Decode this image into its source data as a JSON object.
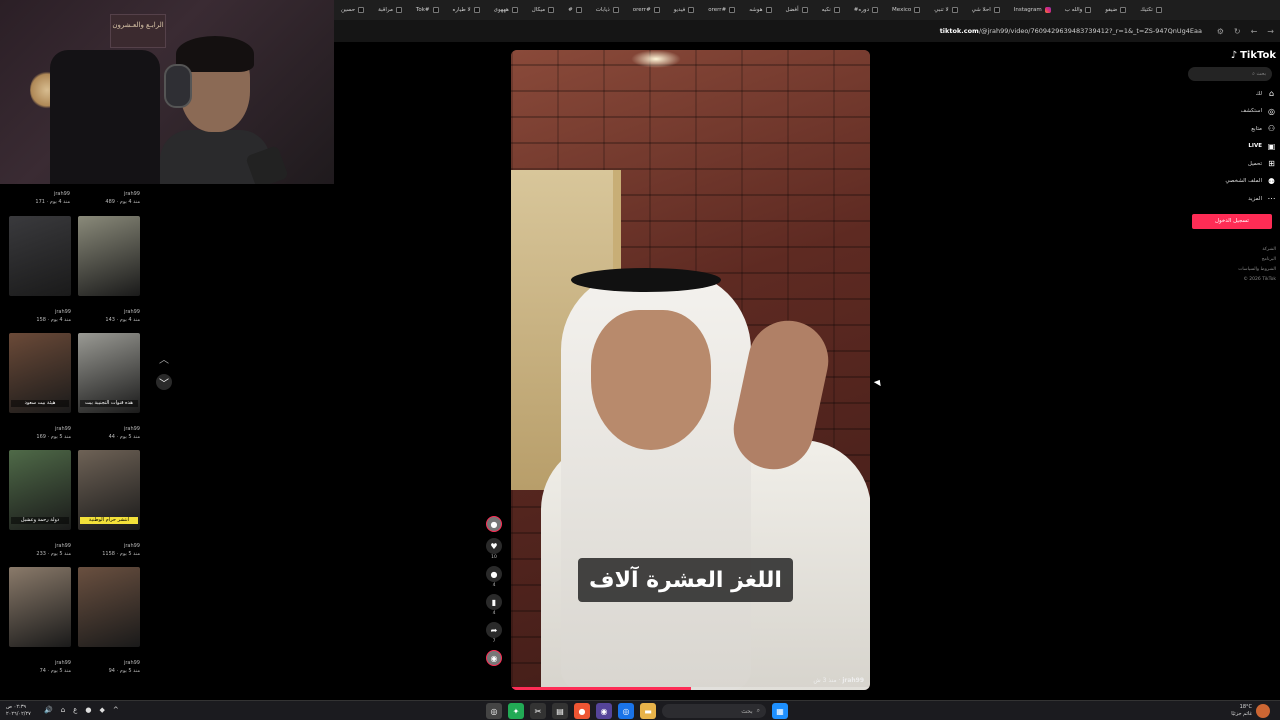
{
  "browser": {
    "tabs": [
      "حسين",
      "مراقبة",
      "Tok#",
      "لا طياره",
      "هههوى",
      "ميكال",
      "#",
      "ذيابات",
      "orerr#",
      "فيديو",
      "orerr#",
      "هوشه",
      "أفضل",
      "نكيه",
      "#دوره",
      "Mexico",
      "لا تنبي",
      "احلا شي",
      "Instagram",
      "والله ب",
      "ضيفو",
      "تكتيك"
    ],
    "url_prefix": "tiktok.com",
    "url_rest": "/@jrah99/video/7609429639483739412?_r=1&_t=ZS-947QnUg4Eaa"
  },
  "webcam": {
    "frame_text": "الرابـع والعـشرون"
  },
  "sidebar": {
    "top_row": [
      {
        "user": "jrah99",
        "meta": "171 · منذ 4 يوم"
      },
      {
        "user": "jrah99",
        "meta": "489 · منذ 4 يوم"
      }
    ],
    "thumbnails": [
      {
        "user": "jrah99",
        "meta": "158 · منذ 4 يوم",
        "caption": "",
        "bg": "#3a3a3d"
      },
      {
        "user": "jrah99",
        "meta": "143 · منذ 4 يوم",
        "caption": "",
        "bg": "#8a8a7a"
      },
      {
        "user": "jrah99",
        "meta": "169 · منذ 5 يوم",
        "caption": "هيئة بيت سعود",
        "bg": "#6b4a38"
      },
      {
        "user": "jrah99",
        "meta": "44 · منذ 5 يوم",
        "caption": "هذه قنوات التجنيبة بيت",
        "bg": "#9a9a94"
      },
      {
        "user": "jrah99",
        "meta": "233 · منذ 5 يوم",
        "caption": "دولة رحمة وعشيل",
        "bg": "#4f6a48"
      },
      {
        "user": "jrah99",
        "meta": "1158 · منذ 5 يوم",
        "caption": "انتشر حرام الوطنية",
        "bg": "#6e6256",
        "yellow": true
      },
      {
        "user": "jrah99",
        "meta": "74 · منذ 5 يوم",
        "caption": "",
        "bg": "#8a7a6a"
      },
      {
        "user": "jrah99",
        "meta": "94 · منذ 5 يوم",
        "caption": "",
        "bg": "#6a5040"
      }
    ]
  },
  "video": {
    "subtitle": "اللغز العشرة آلاف",
    "author": "jrah99",
    "age": "منذ 3 ش",
    "progress": 0.5
  },
  "actions": {
    "likes": "10",
    "comments": "4",
    "saves": "4",
    "shares": "7"
  },
  "tiktok_nav": {
    "logo": "TikTok",
    "search_placeholder": "بحث",
    "items": [
      {
        "label": "لك",
        "icon": "⌂"
      },
      {
        "label": "استكشف",
        "icon": "◎"
      },
      {
        "label": "متابع",
        "icon": "⚇"
      },
      {
        "label": "LIVE",
        "icon": "▣",
        "bold": true
      },
      {
        "label": "تحميل",
        "icon": "⊞"
      },
      {
        "label": "الملف الشخصي",
        "icon": "⚉"
      },
      {
        "label": "المزيد",
        "icon": "⋯"
      }
    ],
    "login": "تسجيل الدخول",
    "footer": [
      "الشركة",
      "البرنامج",
      "الشروط والسياسات",
      "© 2026 TikTok"
    ]
  },
  "taskbar": {
    "time": "٠٢:٣٩ ص",
    "date": "٢٠٢٦/٠٢/٢٧",
    "lang": "ع",
    "search_placeholder": "بحث",
    "weather_temp": "18°C",
    "weather_text": "غائم جزئيًا"
  }
}
